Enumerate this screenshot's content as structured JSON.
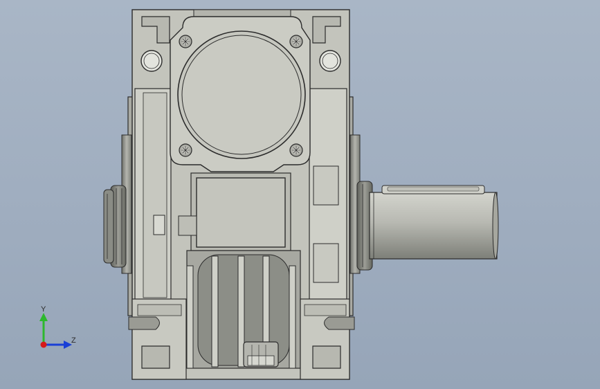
{
  "viewport": {
    "background_top": "#a9b6c6",
    "background_bottom": "#96a5b8",
    "model_name": "worm-gear-reducer",
    "view": "front"
  },
  "model_colors": {
    "body": "#c4c5bd",
    "body_dark": "#8f918a",
    "edge": "#2b2b2b",
    "shaft": "#b9bab3"
  },
  "triad": {
    "y_label": "Y",
    "z_label": "Z",
    "y_color": "#2db82d",
    "z_color": "#1a3fd6",
    "x_color": "#d61a1a"
  }
}
